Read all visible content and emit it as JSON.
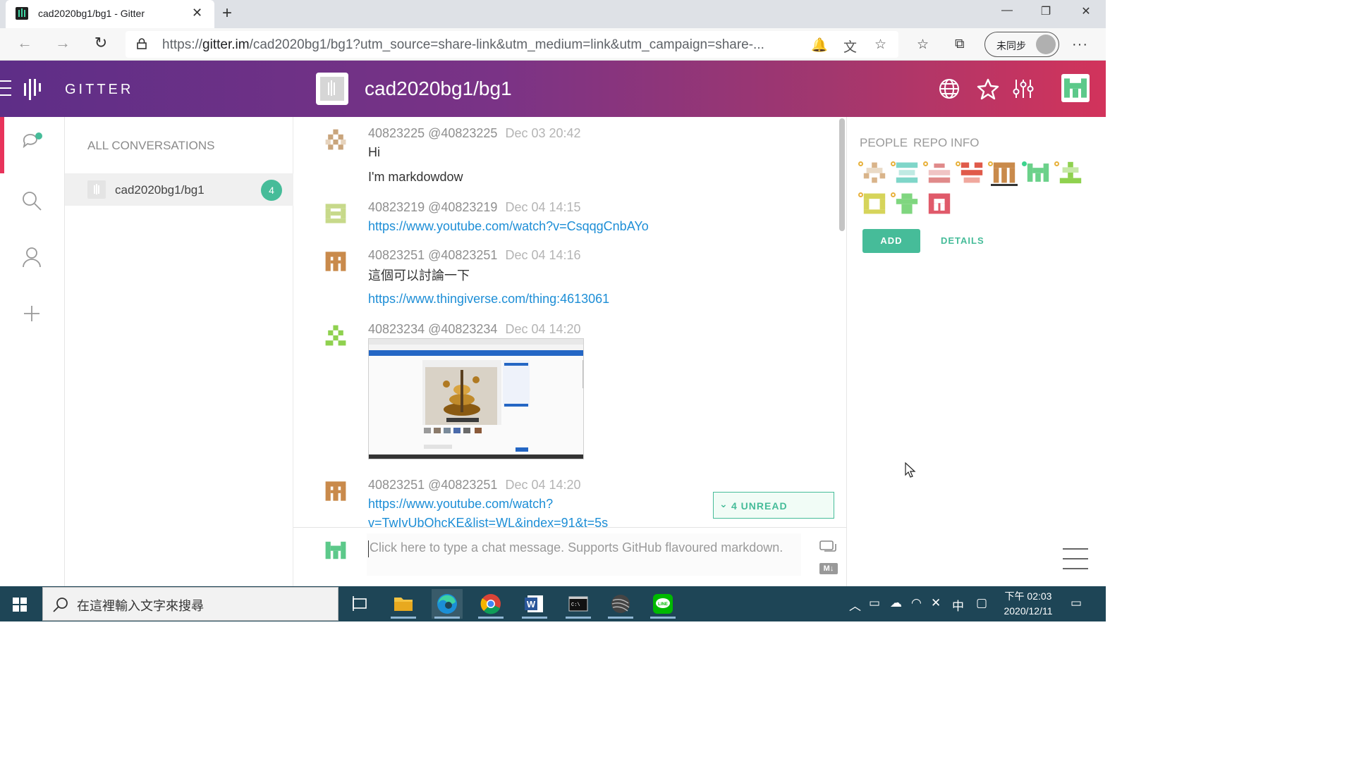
{
  "browser": {
    "tab_title": "cad2020bg1/bg1 - Gitter",
    "new_tab_symbol": "+",
    "url_prefix": "https://",
    "url_host": "gitter.im",
    "url_rest": "/cad2020bg1/bg1?utm_source=share-link&utm_medium=link&utm_campaign=share-...",
    "sync_label": "未同步",
    "more_symbol": "···"
  },
  "header": {
    "brand": "GITTER",
    "room_name": "cad2020bg1/bg1"
  },
  "conversations": {
    "title": "ALL CONVERSATIONS",
    "items": [
      {
        "name": "cad2020bg1/bg1",
        "unread": "4"
      }
    ]
  },
  "messages": [
    {
      "user": "40823225 @40823225",
      "time": "Dec 03 20:42",
      "lines": [
        "Hi",
        "I'm markdowdow"
      ],
      "avatar_color": "#c9a57c"
    },
    {
      "user": "40823219 @40823219",
      "time": "Dec 04 14:15",
      "link": "https://www.youtube.com/watch?v=CsqqgCnbAYo",
      "avatar_color": "#c7d98a"
    },
    {
      "user": "40823251 @40823251",
      "time": "Dec 04 14:16",
      "lines": [
        "這個可以討論一下"
      ],
      "link": "https://www.thingiverse.com/thing:4613061",
      "avatar_color": "#c98a4b"
    },
    {
      "user": "40823234 @40823234",
      "time": "Dec 04 14:20",
      "image": "screenshot",
      "avatar_color": "#8fd14f"
    },
    {
      "user": "40823251 @40823251",
      "time": "Dec 04 14:20",
      "link_lines": [
        "https://www.youtube.com/watch?",
        "v=TwIvUbOhcKE&list=WL&index=91&t=5s"
      ],
      "avatar_color": "#c98a4b"
    }
  ],
  "unread_banner": "4 UNREAD",
  "composer": {
    "placeholder": "Click here to type a chat message. Supports GitHub flavoured markdown.",
    "markdown_badge": "M↓"
  },
  "right_panel": {
    "tabs": [
      "PEOPLE",
      "REPO INFO"
    ],
    "people_colors": [
      "#d9b48a",
      "#7fd6c9",
      "#e08a8a",
      "#e05a4a",
      "#c98a4b",
      "#6bd18a",
      "#8fd14f",
      "#d6d45a",
      "#7fd67f",
      "#e05a6a"
    ],
    "add_label": "ADD",
    "details_label": "DETAILS"
  },
  "taskbar": {
    "search_placeholder": "在這裡輸入文字來搜尋",
    "clock_time": "下午 02:03",
    "clock_date": "2020/12/11",
    "ime": "中"
  },
  "colors": {
    "accent": "#46bc99",
    "link": "#1d8ed6",
    "header_start": "#5e2e87",
    "header_end": "#d2335b"
  }
}
